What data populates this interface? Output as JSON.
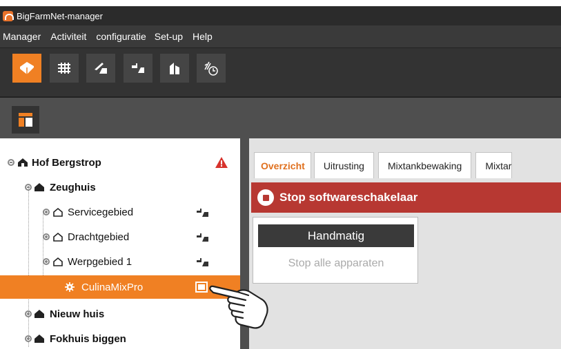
{
  "window": {
    "title": "BigFarmNet-manager"
  },
  "menu": [
    "Manager",
    "Activiteit",
    "configuratie",
    "Set-up",
    "Help"
  ],
  "toolbar": {
    "buttons": [
      {
        "icon": "house-icon",
        "active": true
      },
      {
        "icon": "grid-icon",
        "active": false
      },
      {
        "icon": "field-icon",
        "active": false
      },
      {
        "icon": "pens-icon",
        "active": false
      },
      {
        "icon": "silo-icon",
        "active": false
      },
      {
        "icon": "feed-timer-icon",
        "active": false
      }
    ]
  },
  "toolbar2": {
    "layout_icon": "layout-icon"
  },
  "tree": [
    {
      "label": "Hof Bergstrop",
      "bold": true,
      "level": 0,
      "expanded": true,
      "end_icon": "warning-icon"
    },
    {
      "label": "Zeughuis",
      "bold": true,
      "level": 1,
      "expanded": true
    },
    {
      "label": "Servicegebied",
      "bold": false,
      "level": 2,
      "expanded": false,
      "end_icon": "animals-icon"
    },
    {
      "label": "Drachtgebied",
      "bold": false,
      "level": 2,
      "expanded": false,
      "end_icon": "animals-icon"
    },
    {
      "label": "Werpgebied 1",
      "bold": false,
      "level": 2,
      "expanded": false,
      "end_icon": "animals-icon"
    },
    {
      "label": "CulinaMixPro",
      "bold": false,
      "level": 3,
      "selected": true,
      "end_icon": "device-icon"
    },
    {
      "label": "Nieuw huis",
      "bold": true,
      "level": 1,
      "expanded": false
    },
    {
      "label": "Fokhuis biggen",
      "bold": true,
      "level": 1,
      "expanded": false
    }
  ],
  "tabs": [
    "Overzicht",
    "Uitrusting",
    "Mixtankbewaking",
    "Mixtar"
  ],
  "stop_banner": "Stop softwareschakelaar",
  "manual": {
    "button": "Handmatig",
    "stop_all": "Stop alle apparaten"
  },
  "colors": {
    "accent": "#f08023",
    "stop": "#b73832",
    "dark": "#333333"
  }
}
